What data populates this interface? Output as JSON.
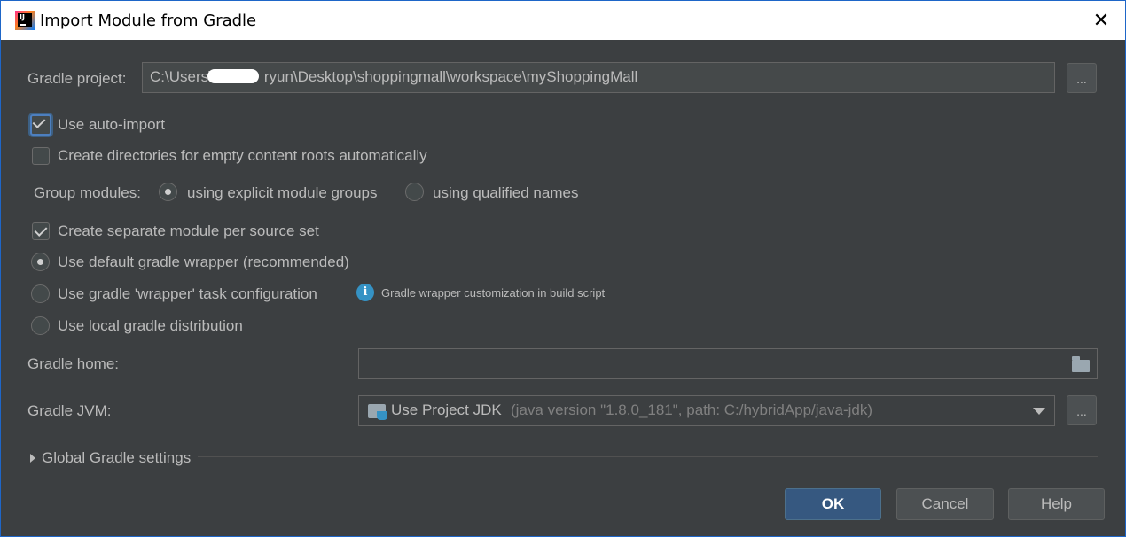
{
  "window": {
    "title": "Import Module from Gradle",
    "app_icon_text": "IJ",
    "close_glyph": "✕"
  },
  "gradle_project": {
    "label": "Gradle project:",
    "path_prefix": "C:\\Users\\",
    "path_suffix": "ryun\\Desktop\\shoppingmall\\workspace\\myShoppingMall",
    "browse_label": "..."
  },
  "options": {
    "use_auto_import": {
      "label": "Use auto-import",
      "checked": true
    },
    "create_dirs": {
      "label": "Create directories for empty content roots automatically",
      "checked": false
    },
    "group_modules": {
      "label": "Group modules:",
      "explicit": {
        "label": "using explicit module groups",
        "selected": true
      },
      "qualified": {
        "label": "using qualified names",
        "selected": false
      }
    },
    "separate_module": {
      "label": "Create separate module per source set",
      "checked": true
    },
    "wrapper_default": {
      "label": "Use default gradle wrapper (recommended)",
      "selected": true
    },
    "wrapper_task": {
      "label": "Use gradle 'wrapper' task configuration",
      "selected": false
    },
    "wrapper_info": "Gradle wrapper customization in build script",
    "local_distribution": {
      "label": "Use local gradle distribution",
      "selected": false
    }
  },
  "gradle_home": {
    "label": "Gradle home:",
    "value": ""
  },
  "gradle_jvm": {
    "label": "Gradle JVM:",
    "selected": "Use Project JDK",
    "detail": "(java version \"1.8.0_181\", path: C:/hybridApp/java-jdk)",
    "browse_label": "..."
  },
  "global_settings": {
    "label": "Global Gradle settings"
  },
  "buttons": {
    "ok": "OK",
    "cancel": "Cancel",
    "help": "Help"
  },
  "colors": {
    "background": "#3c3f41",
    "default_button": "#365880",
    "focus": "#4d7fbf",
    "info": "#3592c4"
  }
}
